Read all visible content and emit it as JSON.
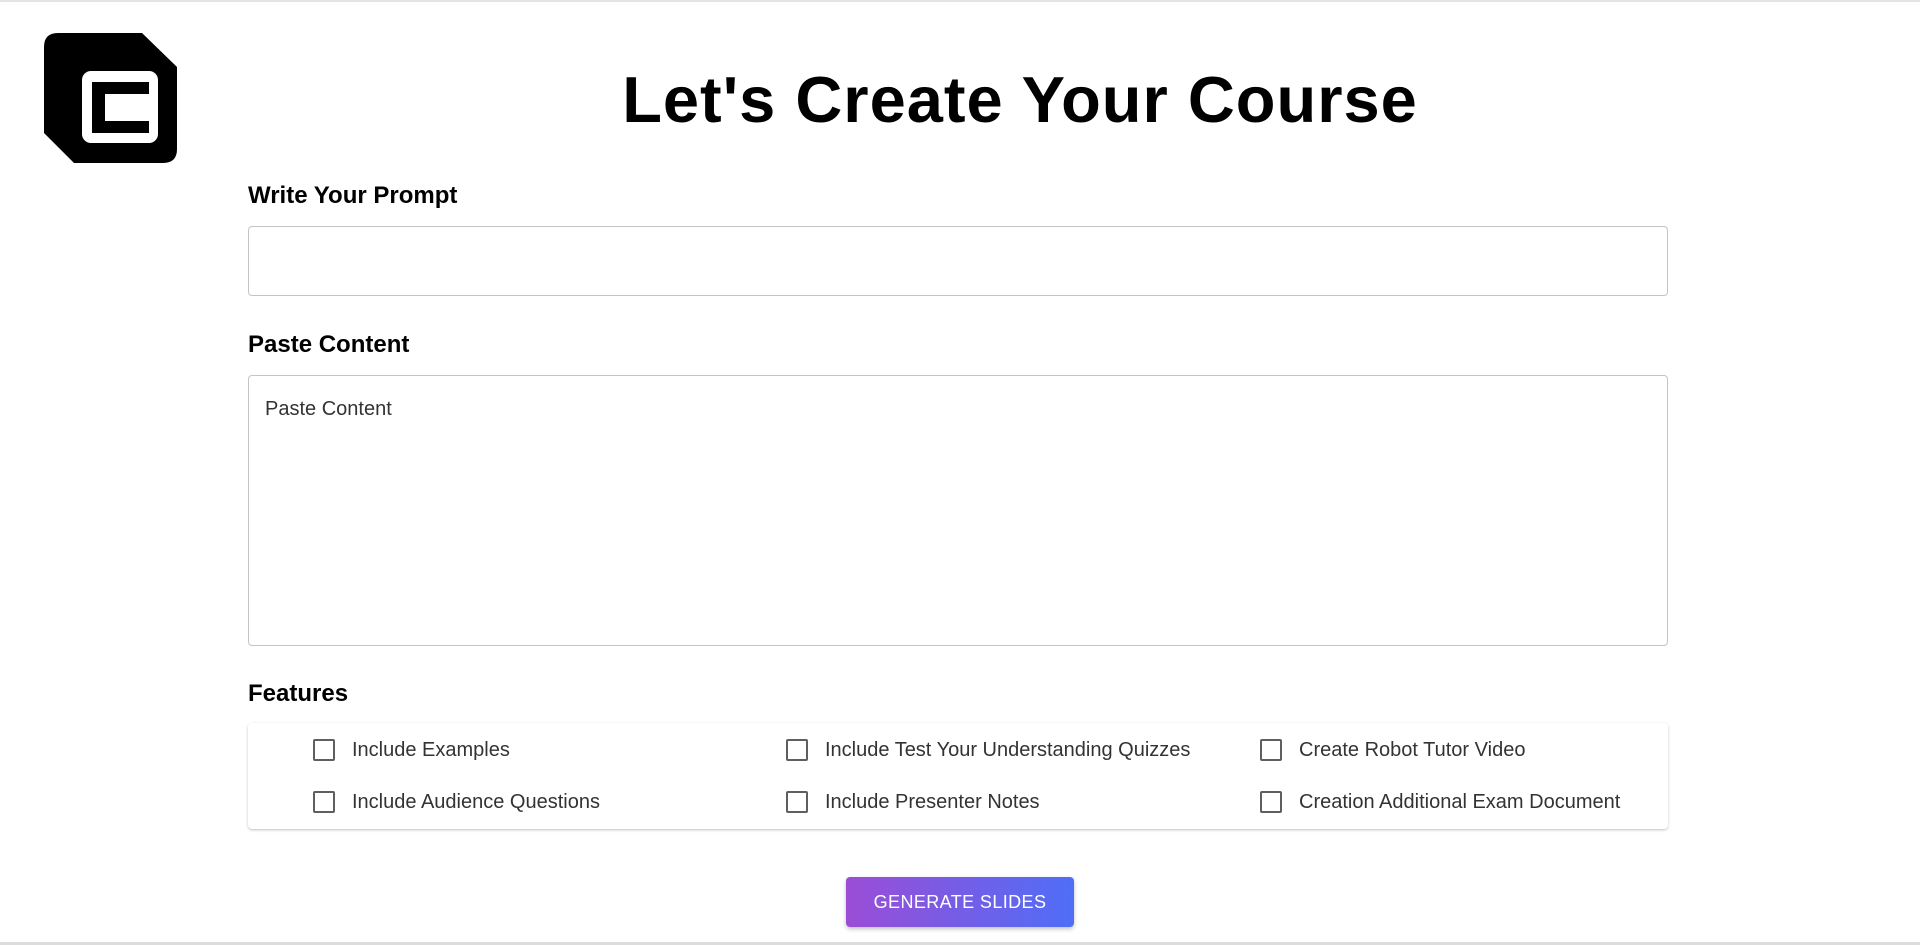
{
  "page": {
    "title": "Let's Create Your Course"
  },
  "logo": {
    "icon": "c-logo-icon"
  },
  "prompt": {
    "label": "Write Your Prompt",
    "value": "",
    "placeholder": ""
  },
  "paste": {
    "label": "Paste Content",
    "value": "",
    "placeholder": "Paste Content"
  },
  "features": {
    "label": "Features",
    "items": [
      {
        "label": "Include Examples",
        "checked": false
      },
      {
        "label": "Include Test Your Understanding Quizzes",
        "checked": false
      },
      {
        "label": "Create Robot Tutor Video",
        "checked": false
      },
      {
        "label": "Include Audience Questions",
        "checked": false
      },
      {
        "label": "Include Presenter Notes",
        "checked": false
      },
      {
        "label": "Creation Additional Exam Document",
        "checked": false
      }
    ]
  },
  "actions": {
    "generate_label": "GENERATE SLIDES"
  },
  "colors": {
    "button_gradient_start": "#9b4dd6",
    "button_gradient_end": "#4f6ef7",
    "logo": "#000000"
  }
}
